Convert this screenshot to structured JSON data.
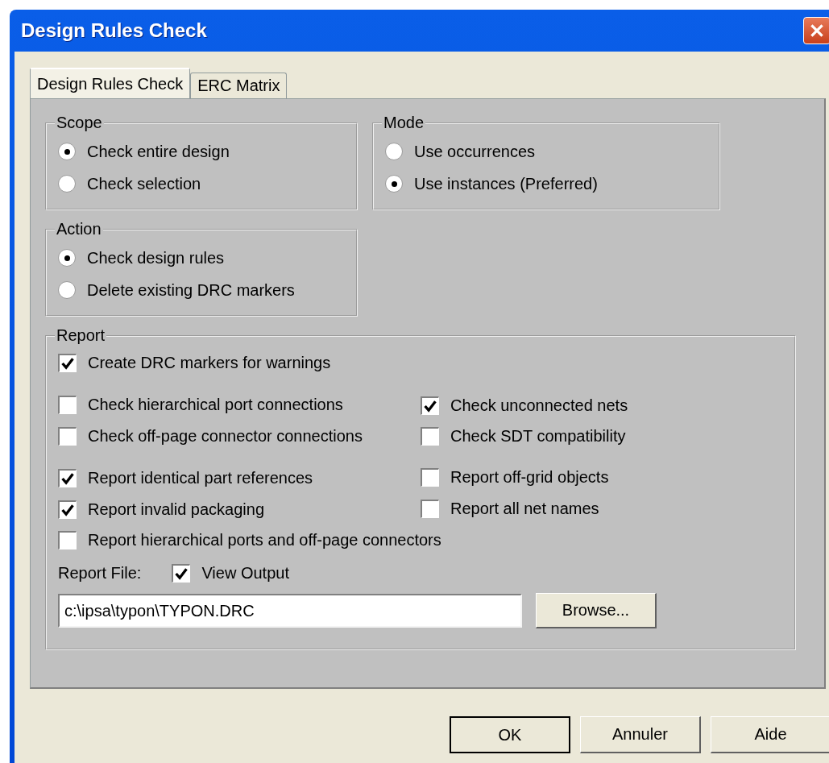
{
  "window": {
    "title": "Design Rules Check"
  },
  "tabs": [
    {
      "label": "Design Rules Check",
      "selected": true
    },
    {
      "label": "ERC Matrix",
      "selected": false
    }
  ],
  "scope": {
    "title": "Scope",
    "options": [
      {
        "label": "Check entire design",
        "selected": true
      },
      {
        "label": "Check selection",
        "selected": false
      }
    ]
  },
  "mode": {
    "title": "Mode",
    "options": [
      {
        "label": "Use occurrences",
        "selected": false
      },
      {
        "label": "Use instances (Preferred)",
        "selected": true
      }
    ]
  },
  "action": {
    "title": "Action",
    "options": [
      {
        "label": "Check design rules",
        "selected": true
      },
      {
        "label": "Delete existing DRC markers",
        "selected": false
      }
    ]
  },
  "report": {
    "title": "Report",
    "blocks": [
      {
        "rows": [
          [
            {
              "label": "Create DRC markers for warnings",
              "checked": true
            }
          ]
        ]
      },
      {
        "rows": [
          [
            {
              "label": "Check hierarchical port connections",
              "checked": false
            },
            {
              "label": "Check unconnected nets",
              "checked": true
            }
          ],
          [
            {
              "label": "Check off-page connector connections",
              "checked": false
            },
            {
              "label": "Check SDT compatibility",
              "checked": false
            }
          ]
        ]
      },
      {
        "rows": [
          [
            {
              "label": "Report identical part references",
              "checked": true
            },
            {
              "label": "Report off-grid objects",
              "checked": false
            }
          ],
          [
            {
              "label": "Report invalid packaging",
              "checked": true
            },
            {
              "label": "Report all net names",
              "checked": false
            }
          ],
          [
            {
              "label": "Report hierarchical ports and off-page connectors",
              "checked": false
            }
          ]
        ]
      }
    ],
    "file_label": "Report File:",
    "view_output": {
      "label": "View Output",
      "checked": true
    },
    "path": "c:\\ipsa\\typon\\TYPON.DRC",
    "browse": "Browse..."
  },
  "buttons": [
    {
      "label": "OK",
      "default": true
    },
    {
      "label": "Annuler",
      "default": false
    },
    {
      "label": "Aide",
      "default": false
    }
  ]
}
